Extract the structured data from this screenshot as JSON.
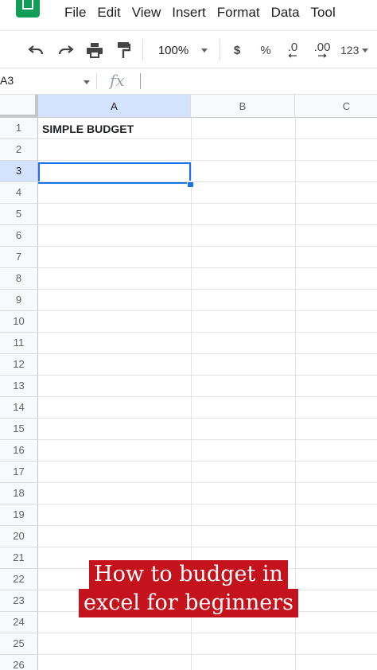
{
  "menu": [
    "File",
    "Edit",
    "View",
    "Insert",
    "Format",
    "Data",
    "Tool"
  ],
  "toolbar": {
    "icons": [
      "undo-icon",
      "redo-icon",
      "print-icon",
      "paint-format-icon"
    ],
    "zoom": "100%",
    "currency": "$",
    "percent": "%",
    "decrease_decimal": ".0",
    "increase_decimal": ".00",
    "more_formats": "123"
  },
  "formula_bar": {
    "name_box": "A3",
    "fx_label": "fx",
    "formula": ""
  },
  "grid": {
    "columns": [
      "A",
      "B",
      "C"
    ],
    "rows": [
      "1",
      "2",
      "3",
      "4",
      "5",
      "6",
      "7",
      "8",
      "9",
      "10",
      "11",
      "12",
      "13",
      "14",
      "15",
      "16",
      "17",
      "18",
      "19",
      "20",
      "21",
      "22",
      "23",
      "24",
      "25",
      "26"
    ],
    "selected_cell": "A3",
    "cells": {
      "A1": "SIMPLE BUDGET"
    }
  },
  "caption": {
    "line1": "How to budget in",
    "line2": "excel for beginners"
  },
  "colors": {
    "accent": "#1a73e8",
    "caption_bg": "#c4131c",
    "logo": "#0f9d58"
  }
}
